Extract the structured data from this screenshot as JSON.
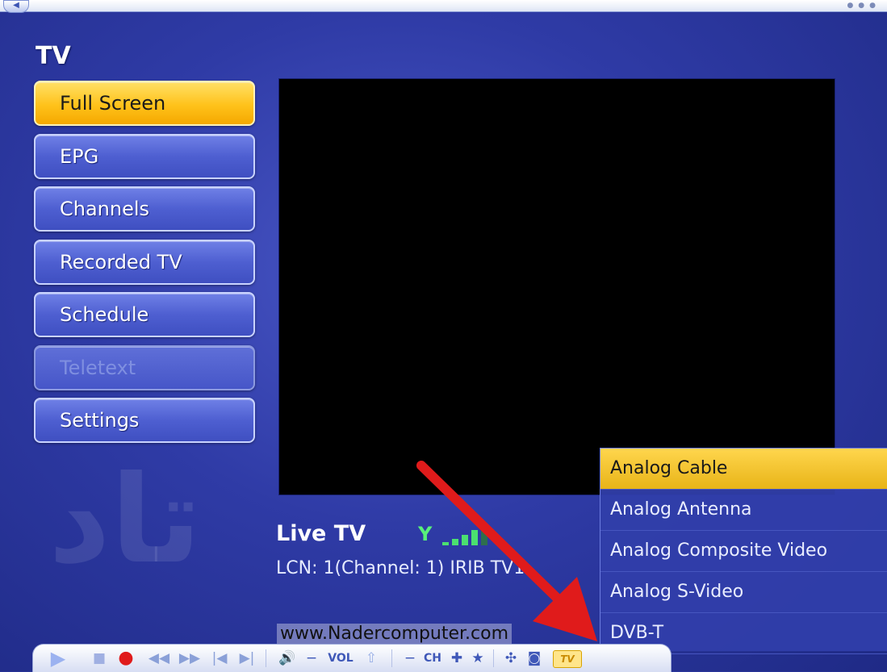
{
  "window": {
    "title": "TV"
  },
  "menu": {
    "items": [
      {
        "label": "Full Screen",
        "state": "active"
      },
      {
        "label": "EPG",
        "state": "normal"
      },
      {
        "label": "Channels",
        "state": "normal"
      },
      {
        "label": "Recorded TV",
        "state": "normal"
      },
      {
        "label": "Schedule",
        "state": "normal"
      },
      {
        "label": "Teletext",
        "state": "disabled"
      },
      {
        "label": "Settings",
        "state": "normal"
      }
    ]
  },
  "status": {
    "title": "Live TV",
    "signal_icon": "antenna-signal-icon",
    "channel_info": "LCN: 1(Channel: 1) IRIB TV1"
  },
  "source_dropdown": {
    "selected": "Analog Cable",
    "options": [
      "Analog Cable",
      "Analog Antenna",
      "Analog Composite Video",
      "Analog S-Video",
      "DVB-T"
    ]
  },
  "watermark": {
    "text": "www.Nadercomputer.com"
  },
  "controls": {
    "vol_label": "VOL",
    "ch_label": "CH",
    "tv_label": "TV"
  },
  "colors": {
    "background": "#2f3ba6",
    "active_button": "#ffc21a",
    "button": "#4e5fd1",
    "annotation_arrow": "#e01b1b"
  }
}
